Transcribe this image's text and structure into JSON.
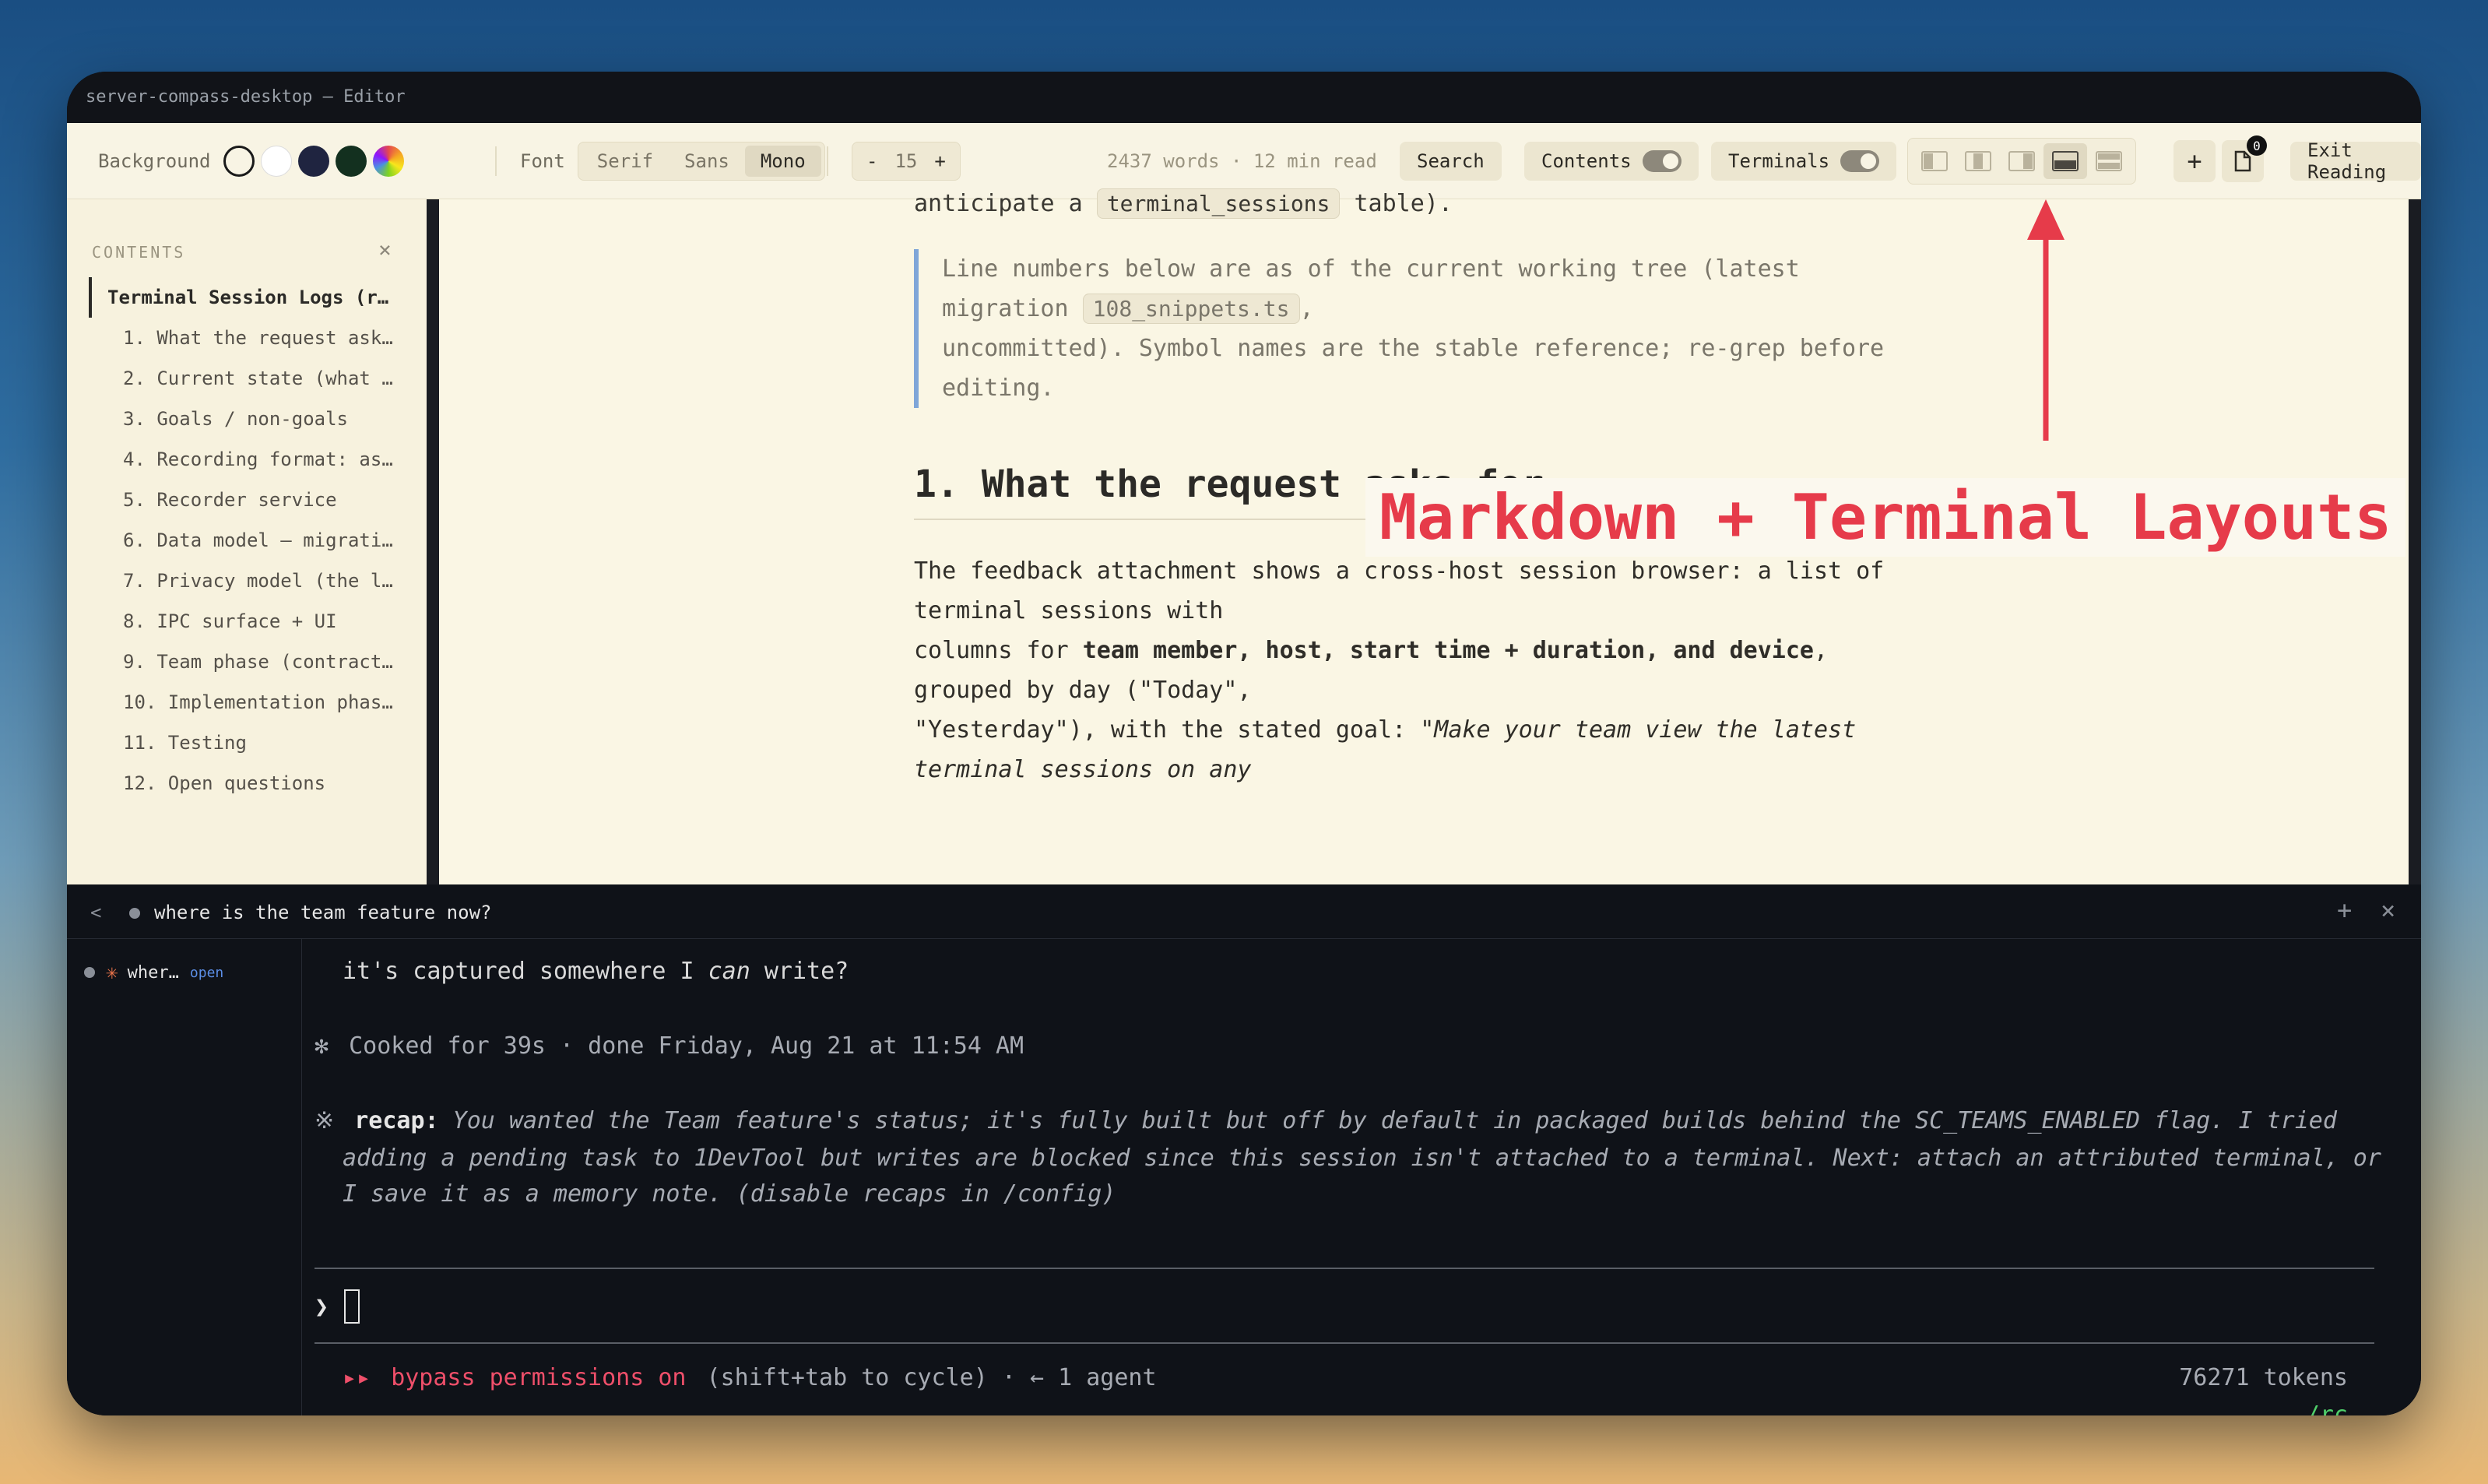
{
  "window": {
    "title": "server-compass-desktop — Editor"
  },
  "toolbar": {
    "background_label": "Background",
    "swatches": [
      "#111111",
      "#ffffff",
      "#1f2440",
      "#13301f",
      "rainbow"
    ],
    "font_label": "Font",
    "fonts": [
      "Serif",
      "Sans",
      "Mono"
    ],
    "active_font": "Mono",
    "decrease": "-",
    "size": "15",
    "increase": "+",
    "stats": "2437 words · 12 min read",
    "search": "Search",
    "contents": "Contents",
    "terminals": "Terminals",
    "layouts": [
      "layout-left-split-icon",
      "layout-center-split-icon",
      "layout-right-split-icon",
      "layout-bottom-split-icon",
      "layout-stack-icon"
    ],
    "active_layout": 3,
    "add": "+",
    "file_badge": "0",
    "exit": "Exit Reading"
  },
  "sidebar": {
    "heading": "CONTENTS",
    "close": "×",
    "items": [
      "Terminal Session Logs (r…",
      "1. What the request ask…",
      "2. Current state (what …",
      "3. Goals / non-goals",
      "4. Recording format: as…",
      "5. Recorder service",
      "6. Data model — migrati…",
      "7. Privacy model (the l…",
      "8. IPC surface + UI",
      "9. Team phase (contract…",
      "10. Implementation phas…",
      "11. Testing",
      "12. Open questions"
    ]
  },
  "doc": {
    "top_line_prefix": "anticipate a ",
    "top_line_code": "terminal_sessions",
    "top_line_suffix": " table).",
    "quote_line1": "Line numbers below are as of the current working tree (latest",
    "quote_line2_prefix": "migration ",
    "quote_line2_code": "108_snippets.ts",
    "quote_line2_suffix": ",",
    "quote_line3": "uncommitted). Symbol names are the stable reference; re-grep before",
    "quote_line4": "editing.",
    "heading": "1. What the request asks for",
    "p1": "The feedback attachment shows a cross-host session browser: a list of",
    "p2": "terminal sessions with",
    "p3_prefix": "columns for ",
    "p3_bold": "team member, host, start time + duration, and device",
    "p3_suffix": ",",
    "p4": "grouped by day (\"Today\",",
    "p5_prefix": "\"Yesterday\"), with the stated goal: ",
    "p5_italic": "\"Make your team view the latest",
    "p6_italic": "terminal sessions on any"
  },
  "overlay": {
    "text": "Markdown + Terminal Layouts"
  },
  "terminal": {
    "back": "<",
    "tab_title": "where is the team feature now?",
    "add": "+",
    "close": "×",
    "session_name": "wher…",
    "session_status": "open",
    "line1_prefix": "it's captured somewhere I ",
    "line1_italic": "can",
    "line1_suffix": " write?",
    "cooked_mark": "✻",
    "cooked": "Cooked for 39s · done Friday, Aug 21 at 11:54 AM",
    "recap_mark": "※",
    "recap_label": "recap:",
    "recap_text_1": "You wanted the Team feature's status; it's fully built but off by default in packaged builds behind the SC_TEAMS_ENABLED flag. I tried",
    "recap_text_2": "adding a pending task to 1DevTool but writes are blocked since this session isn't attached to a terminal. Next: attach an attributed terminal, or",
    "recap_text_3": "I save it as a memory note. (disable recaps in /config)",
    "prompt": "❯",
    "status_arrows": "▸▸",
    "status_bypass": "bypass permissions on",
    "status_rest": "(shift+tab to cycle) · ← 1 agent",
    "tokens": "76271 tokens",
    "rc": "/rc"
  }
}
